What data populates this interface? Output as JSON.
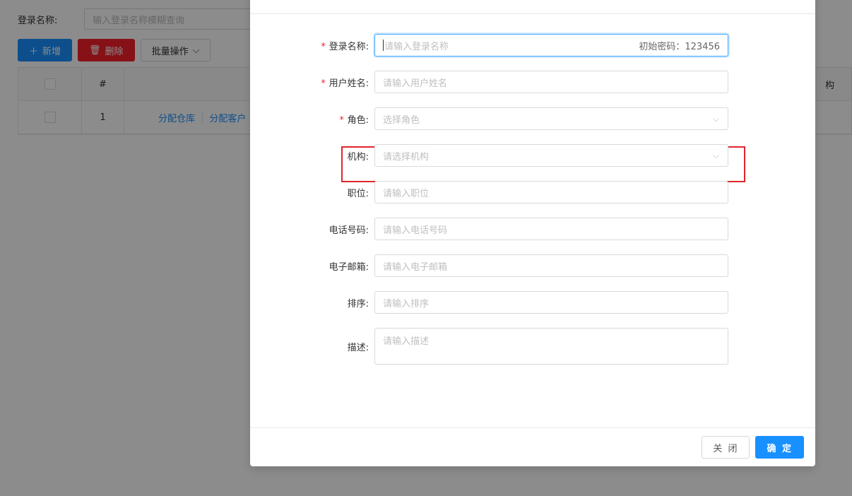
{
  "page": {
    "search": {
      "label": "登录名称:",
      "placeholder": "输入登录名称模糊查询"
    },
    "toolbar": {
      "add_label": "新增",
      "delete_label": "删除",
      "batch_label": "批量操作"
    },
    "table": {
      "header": {
        "index": "#",
        "right_partial": "构"
      },
      "rows": [
        {
          "index": "1",
          "action1": "分配仓库",
          "action2": "分配客户"
        }
      ]
    }
  },
  "modal": {
    "title": "",
    "form": {
      "login_name": {
        "label": "登录名称:",
        "placeholder": "请输入登录名称",
        "suffix": "初始密码：123456",
        "required": true
      },
      "user_name": {
        "label": "用户姓名:",
        "placeholder": "请输入用户姓名",
        "required": true
      },
      "role": {
        "label": "角色:",
        "placeholder": "选择角色",
        "required": true
      },
      "org": {
        "label": "机构:",
        "placeholder": "请选择机构"
      },
      "position": {
        "label": "职位:",
        "placeholder": "请输入职位"
      },
      "phone": {
        "label": "电话号码:",
        "placeholder": "请输入电话号码"
      },
      "email": {
        "label": "电子邮箱:",
        "placeholder": "请输入电子邮箱"
      },
      "sort": {
        "label": "排序:",
        "placeholder": "请输入排序"
      },
      "desc": {
        "label": "描述:",
        "placeholder": "请输入描述"
      }
    },
    "footer": {
      "close_label": "关 闭",
      "ok_label": "确 定"
    }
  },
  "colors": {
    "accent": "#1890ff",
    "danger": "#f5222d",
    "highlight": "#e0252b"
  }
}
